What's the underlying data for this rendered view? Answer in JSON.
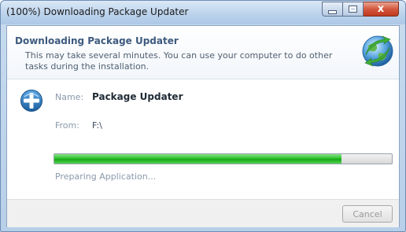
{
  "window": {
    "title": "(100%) Downloading Package Updater",
    "controls": {
      "minimize": "minimize",
      "maximize": "maximize",
      "close": "x"
    }
  },
  "header": {
    "title": "Downloading Package Updater",
    "description": "This may take several minutes. You can use your computer to do other tasks during the installation.",
    "icon": "globe-install-icon"
  },
  "details": {
    "app_icon": "plus-circle-icon",
    "name_label": "Name:",
    "name_value": "Package Updater",
    "from_label": "From:",
    "from_value": "F:\\"
  },
  "progress": {
    "fraction": 0.85,
    "status": "Preparing Application..."
  },
  "footer": {
    "cancel_label": "Cancel"
  },
  "colors": {
    "accent_title": "#3d5a7e",
    "progress_green": "#2ec42e",
    "close_button": "#c03a20"
  }
}
